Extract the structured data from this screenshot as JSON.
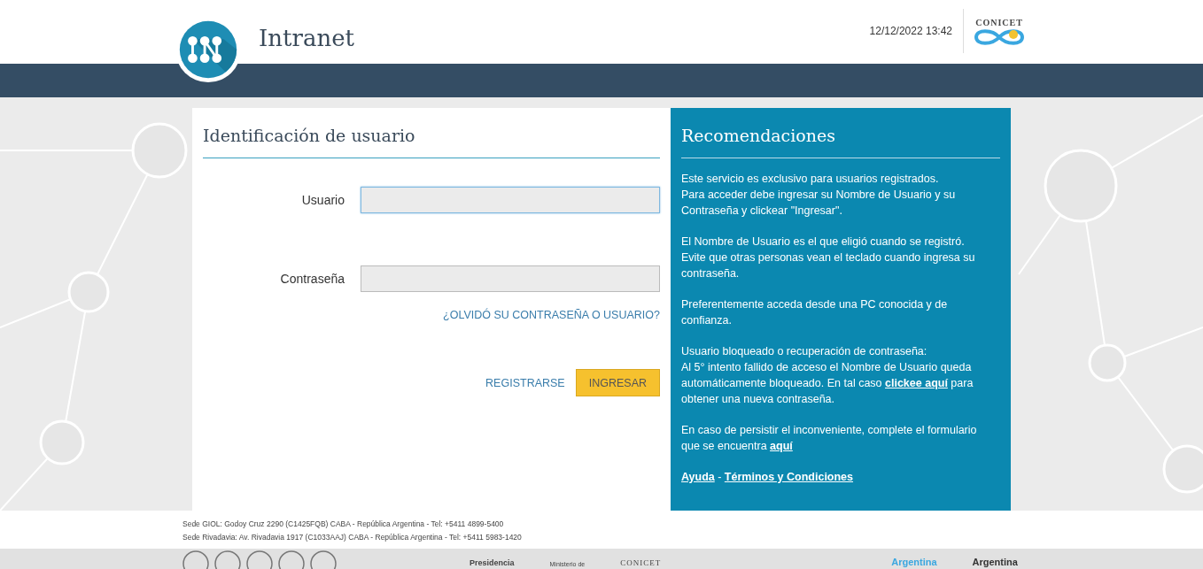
{
  "header": {
    "title": "Intranet",
    "datetime": "12/12/2022 13:42",
    "org_logo_text": "CONICET"
  },
  "login": {
    "title": "Identificación de usuario",
    "fields": [
      {
        "label": "Usuario",
        "focused": true
      },
      {
        "label": "Contraseña",
        "focused": false
      }
    ],
    "forgot_link": "¿OLVIDÓ SU CONTRASEÑA O USUARIO?",
    "register_link": "REGISTRARSE",
    "submit_button": "INGRESAR"
  },
  "recommendations": {
    "title": "Recomendaciones",
    "paragraphs": [
      {
        "lines": [
          [
            {
              "kind": "text",
              "text": "Este servicio es exclusivo para usuarios registrados."
            }
          ],
          [
            {
              "kind": "text",
              "text": "Para acceder debe ingresar su Nombre de Usuario y su Contraseña y clickear \"Ingresar\"."
            }
          ]
        ]
      },
      {
        "lines": [
          [
            {
              "kind": "text",
              "text": "El Nombre de Usuario es el que eligió cuando se registró."
            }
          ],
          [
            {
              "kind": "text",
              "text": "Evite que otras personas vean el teclado cuando ingresa su contraseña."
            }
          ]
        ]
      },
      {
        "lines": [
          [
            {
              "kind": "text",
              "text": "Preferentemente acceda desde una PC conocida y de confianza."
            }
          ]
        ]
      },
      {
        "lines": [
          [
            {
              "kind": "text",
              "text": "Usuario bloqueado o recuperación de contraseña:"
            }
          ],
          [
            {
              "kind": "text",
              "text": "Al 5° intento fallido de acceso el Nombre de Usuario queda automáticamente bloqueado. En tal caso "
            },
            {
              "kind": "link",
              "text": "clickee aquí"
            },
            {
              "kind": "text",
              "text": " para obtener una nueva contraseña."
            }
          ]
        ]
      },
      {
        "lines": [
          [
            {
              "kind": "text",
              "text": "En caso de persistir el inconveniente, complete el formulario que se encuentra "
            },
            {
              "kind": "link",
              "text": "aquí"
            }
          ]
        ]
      },
      {
        "lines": [
          [
            {
              "kind": "link",
              "text": "Ayuda"
            },
            {
              "kind": "text",
              "text": " - "
            },
            {
              "kind": "link",
              "text": "Términos y Condiciones"
            }
          ]
        ]
      }
    ]
  },
  "footer": {
    "addresses": [
      "Sede GIOL: Godoy Cruz 2290 (C1425FQB) CABA - República Argentina - Tel: +5411 4899-5400",
      "Sede Rivadavia: Av. Rivadavia 1917 (C1033AAJ) CABA - República Argentina - Tel: +5411 5983-1420"
    ],
    "logos": [
      {
        "kind": "presidencia",
        "text": "Presidencia"
      },
      {
        "kind": "ministerio",
        "text": "Ministerio de"
      },
      {
        "kind": "conicet",
        "text": "CONICET"
      },
      {
        "kind": "argentina",
        "text": "Argentina"
      },
      {
        "kind": "argentina2",
        "text": "Argentina"
      }
    ]
  }
}
